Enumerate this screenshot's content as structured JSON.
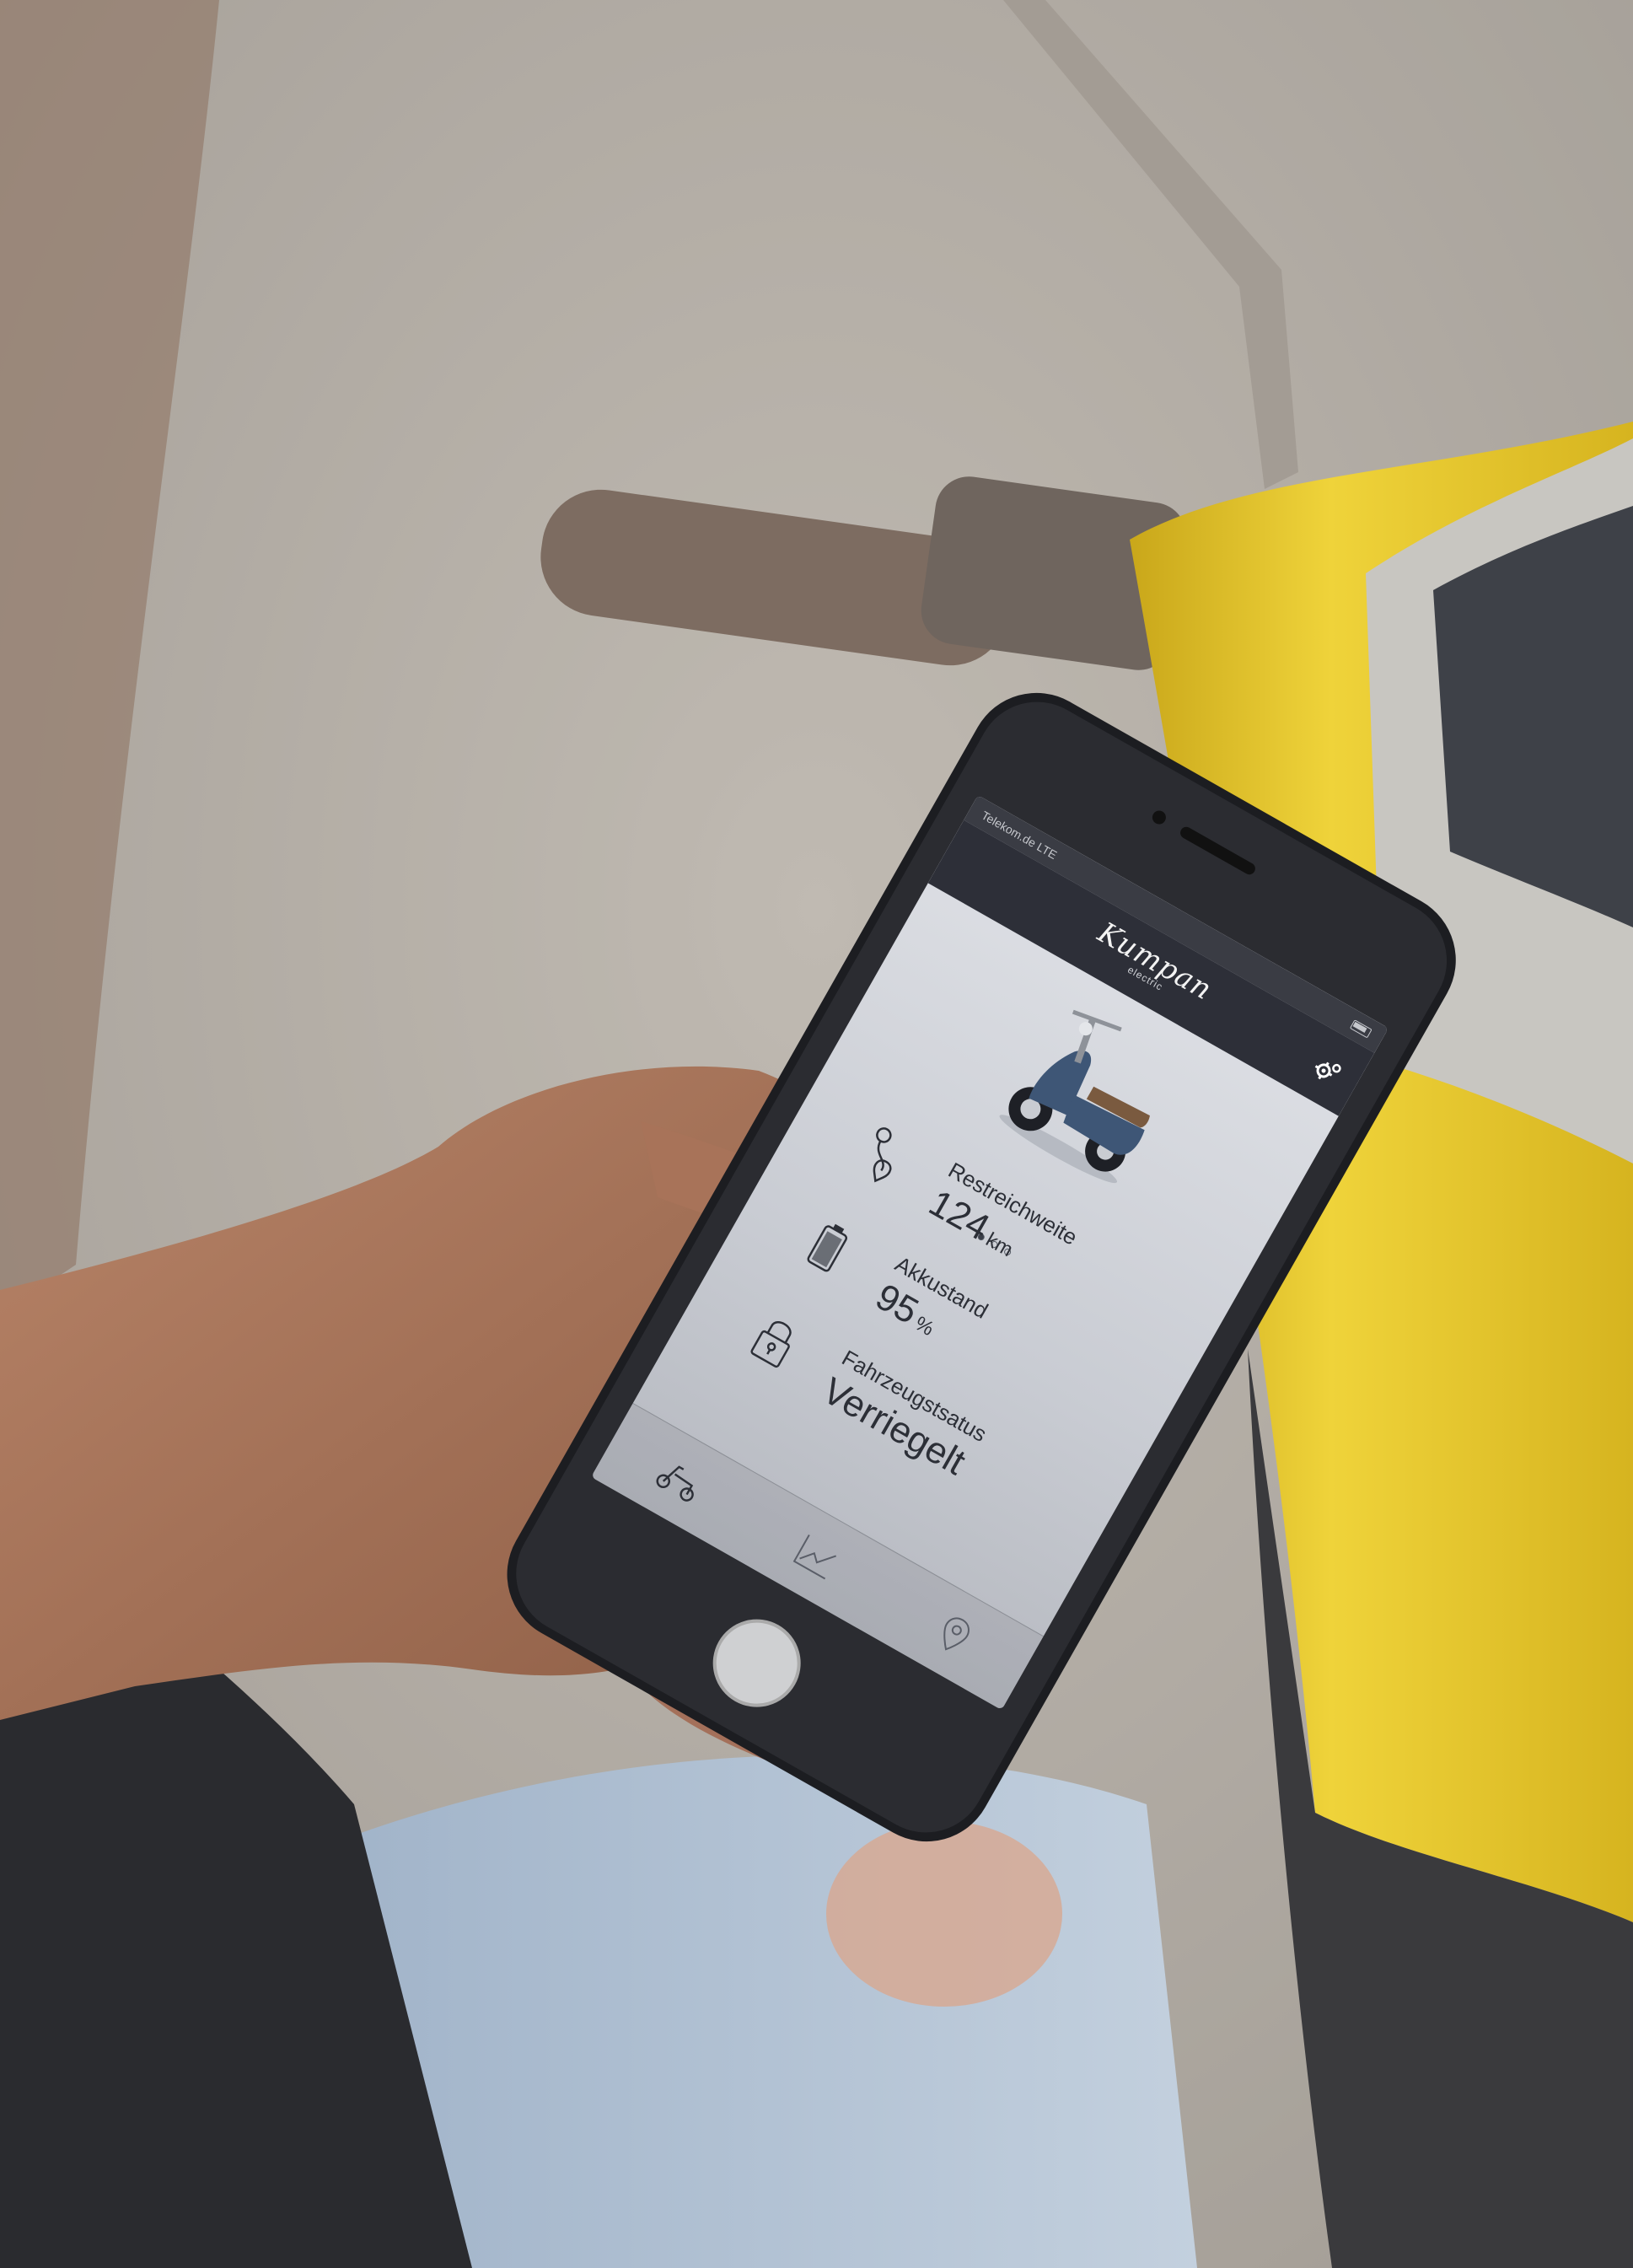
{
  "app": {
    "brand": "Kumpan",
    "brand_sub": "electric",
    "status_carrier": "Telekom.de",
    "status_network": "LTE"
  },
  "vehicle": {
    "image": "scooter-image",
    "carousel_pages": 3,
    "carousel_active": 0
  },
  "stats": {
    "range": {
      "label": "Restreichweite",
      "value": "124",
      "unit": "km",
      "icon": "location-pin-route-icon"
    },
    "battery": {
      "label": "Akkustand",
      "value": "95",
      "unit": "%",
      "icon": "battery-icon"
    },
    "lock": {
      "label": "Fahrzeugstsatus",
      "value": "Verriegelt",
      "icon": "padlock-icon"
    }
  },
  "tabs": [
    {
      "name": "scooter",
      "icon": "scooter-icon"
    },
    {
      "name": "statistics",
      "icon": "line-chart-icon"
    },
    {
      "name": "map",
      "icon": "map-pin-icon"
    }
  ],
  "colors": {
    "header": "#2d2f38",
    "screen_bg": "#dfe1e6",
    "scooter_body": "#3e5676",
    "accent_yellow": "#e8c629"
  }
}
